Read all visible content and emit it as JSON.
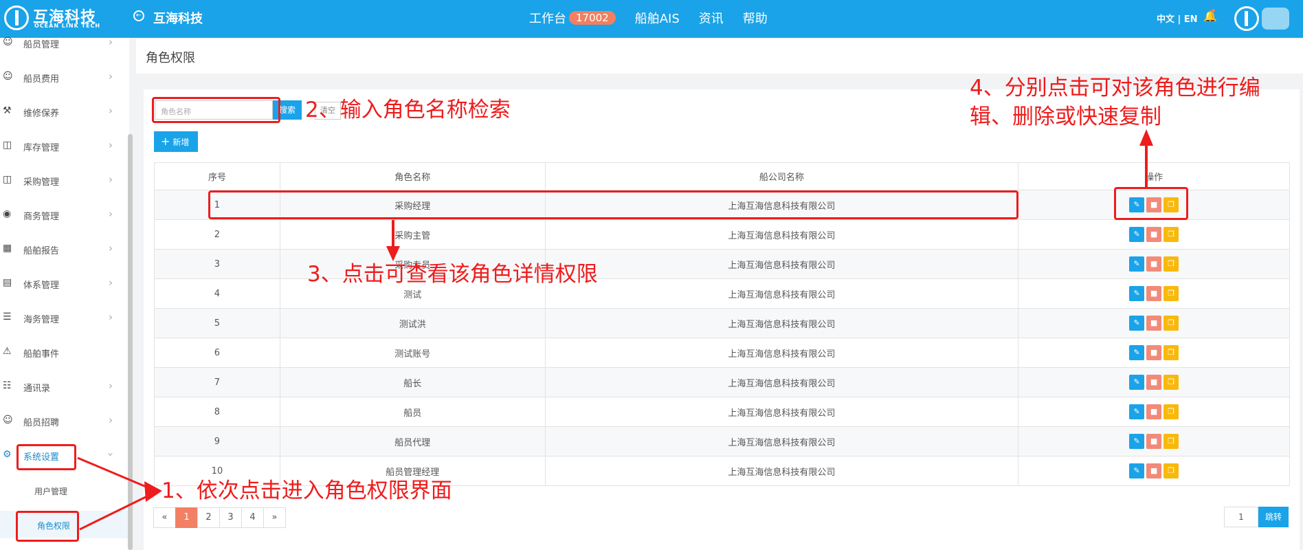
{
  "header": {
    "brand_cn": "互海科技",
    "brand_en": "OCEAN LINK TECH",
    "app_title": "互海科技",
    "nav": [
      {
        "label": "工作台",
        "badge": "17002"
      },
      {
        "label": "船舶AIS"
      },
      {
        "label": "资讯"
      },
      {
        "label": "帮助"
      }
    ],
    "lang": "中文 | EN"
  },
  "sidebar": {
    "items": [
      {
        "label": "船员管理",
        "icon": "person-icon"
      },
      {
        "label": "船员费用",
        "icon": "person-icon"
      },
      {
        "label": "维修保养",
        "icon": "hammer-icon"
      },
      {
        "label": "库存管理",
        "icon": "bag-icon"
      },
      {
        "label": "采购管理",
        "icon": "bag-icon"
      },
      {
        "label": "商务管理",
        "icon": "globe-icon"
      },
      {
        "label": "船舶报告",
        "icon": "calendar-icon"
      },
      {
        "label": "体系管理",
        "icon": "document-icon"
      },
      {
        "label": "海务管理",
        "icon": "signpost-icon"
      },
      {
        "label": "船舶事件",
        "icon": "warning-icon"
      },
      {
        "label": "通讯录",
        "icon": "contacts-icon"
      },
      {
        "label": "船员招聘",
        "icon": "person-icon"
      },
      {
        "label": "系统设置",
        "icon": "gear-icon"
      }
    ],
    "sub_items": [
      {
        "label": "用户管理"
      },
      {
        "label": "角色权限"
      }
    ]
  },
  "breadcrumb": "角色权限",
  "search": {
    "placeholder": "角色名称",
    "search_label": "搜索",
    "clear_label": "清空"
  },
  "add_label": "新增",
  "table": {
    "headers": [
      "序号",
      "角色名称",
      "船公司名称",
      "操作"
    ],
    "rows": [
      {
        "no": "1",
        "role": "采购经理",
        "company": "上海互海信息科技有限公司"
      },
      {
        "no": "2",
        "role": "采购主管",
        "company": "上海互海信息科技有限公司"
      },
      {
        "no": "3",
        "role": "采购专员",
        "company": "上海互海信息科技有限公司"
      },
      {
        "no": "4",
        "role": "测试",
        "company": "上海互海信息科技有限公司"
      },
      {
        "no": "5",
        "role": "测试洪",
        "company": "上海互海信息科技有限公司"
      },
      {
        "no": "6",
        "role": "测试账号",
        "company": "上海互海信息科技有限公司"
      },
      {
        "no": "7",
        "role": "船长",
        "company": "上海互海信息科技有限公司"
      },
      {
        "no": "8",
        "role": "船员",
        "company": "上海互海信息科技有限公司"
      },
      {
        "no": "9",
        "role": "船员代理",
        "company": "上海互海信息科技有限公司"
      },
      {
        "no": "10",
        "role": "船员管理经理",
        "company": "上海互海信息科技有限公司"
      }
    ]
  },
  "pagination": {
    "prev": "«",
    "pages": [
      "1",
      "2",
      "3",
      "4"
    ],
    "next": "»",
    "current": "1",
    "jump_value": "1",
    "jump_label": "跳转"
  },
  "annotations": {
    "step1": "1、依次点击进入角色权限界面",
    "step2": "2、输入角色名称检索",
    "step3": "3、点击可查看该角色详情权限",
    "step4_line1": "4、分别点击可对该角色进行编",
    "step4_line2": "辑、删除或快速复制"
  },
  "colors": {
    "primary": "#1aa3e8",
    "annotation": "#ee1c1c",
    "delete": "#f28a7a",
    "copy": "#f9b90c",
    "badge": "#f08060"
  }
}
